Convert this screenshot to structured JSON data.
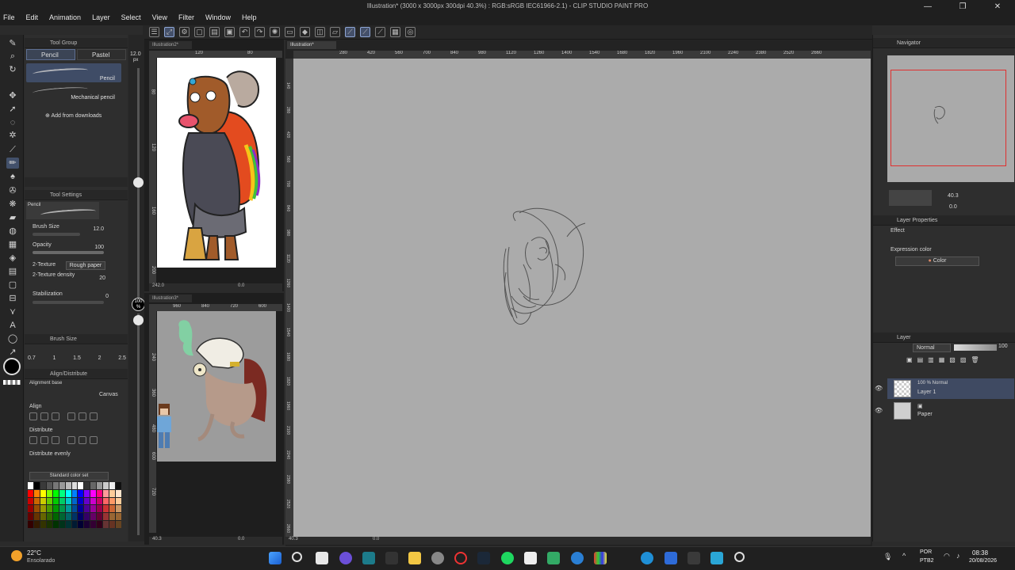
{
  "window": {
    "title": "Illustration* (3000 x 3000px 300dpi 40.3%) : RGB:sRGB IEC61966-2.1) - CLIP STUDIO PAINT PRO",
    "controls": [
      "—",
      "❐",
      "✕"
    ]
  },
  "menu": [
    "File",
    "Edit",
    "Animation",
    "Layer",
    "Select",
    "View",
    "Filter",
    "Window",
    "Help"
  ],
  "sub_tool": {
    "group_title": "Tool Group",
    "tabs": [
      "Pencil",
      "Pastel"
    ],
    "brushes": [
      "Pencil",
      "Mechanical pencil"
    ],
    "add_downloads": "Add from downloads"
  },
  "tool_settings": {
    "title": "Tool Settings",
    "preview_name": "Pencil",
    "brush_size_label": "Brush Size",
    "brush_size_value": "12.0",
    "opacity_label": "Opacity",
    "opacity_value": "100",
    "texture_label": "2-Texture",
    "texture_value": "Rough paper",
    "texture_density_label": "2-Texture density",
    "texture_density_value": "20",
    "stabilization_label": "Stabilization",
    "stabilization_value": "0"
  },
  "brush_size_panel": {
    "title": "Brush Size",
    "sizes": [
      "0.7",
      "1",
      "1.5",
      "2",
      "2.5"
    ]
  },
  "align_panel": {
    "title": "Align/Distribute",
    "alignment_base_label": "Alignment base",
    "alignment_base_value": "Canvas",
    "align_label": "Align",
    "distribute_label": "Distribute",
    "distribute_evenly_label": "Distribute evenly"
  },
  "color_set": {
    "name": "Standard color set"
  },
  "vertical_slider": {
    "size_value": "12.0",
    "size_unit": "px",
    "opacity_value": "100",
    "opacity_unit": "%"
  },
  "sub_views": [
    {
      "tab": "Illustration2*",
      "ruler_top": [
        "120",
        "80"
      ],
      "ruler_left": [
        "80",
        "120",
        "160",
        "200"
      ],
      "status": [
        "242.0",
        "0.0"
      ]
    },
    {
      "tab": "Illustration3*",
      "ruler_top": [
        "960",
        "840",
        "720",
        "600"
      ],
      "ruler_left": [
        "240",
        "360",
        "480",
        "600",
        "720"
      ],
      "status": [
        "40.3",
        "0.0"
      ]
    }
  ],
  "main_view": {
    "tab": "Illustration*",
    "ruler_top": [
      "280",
      "420",
      "560",
      "700",
      "840",
      "980",
      "1120",
      "1260",
      "1400",
      "1540",
      "1680",
      "1820",
      "1960",
      "2100",
      "2240",
      "2380",
      "2520",
      "2660"
    ],
    "ruler_left": [
      "140",
      "280",
      "420",
      "560",
      "700",
      "840",
      "980",
      "1120",
      "1260",
      "1400",
      "1540",
      "1680",
      "1820",
      "1960",
      "2100",
      "2240",
      "2380",
      "2520",
      "2660"
    ],
    "status_zoom": "40.3",
    "status_angle": "0.0"
  },
  "navigator": {
    "title": "Navigator",
    "zoom": "40.3",
    "angle": "0.0"
  },
  "layer_property": {
    "title": "Layer Properties",
    "effect_label": "Effect",
    "expression_color_label": "Expression color",
    "expression_color_value": "Color"
  },
  "layer_panel": {
    "title": "Layer",
    "blend_mode": "Normal",
    "opacity": "100",
    "layers": [
      {
        "mode": "100 % Normal",
        "name": "Layer 1",
        "selected": true
      },
      {
        "mode": "",
        "name": "Paper",
        "selected": false
      }
    ]
  },
  "taskbar": {
    "weather_temp": "22°C",
    "weather_desc": "Ensolarado",
    "language": "POR",
    "keyboard": "PTB2",
    "time": "08:38",
    "date": "20/08/2026"
  },
  "colors": {
    "accent": "#42506a",
    "canvas_bg": "#ababab",
    "panel_bg": "#2e2e2e",
    "nav_frame": "#e0302f"
  }
}
